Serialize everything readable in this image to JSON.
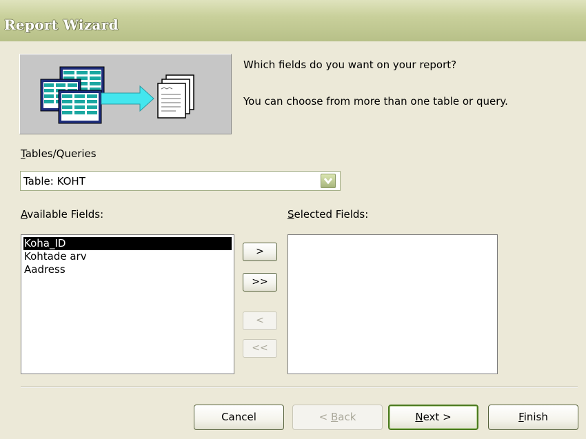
{
  "window": {
    "title": "Report Wizard"
  },
  "prompt": {
    "line1": "Which fields do you want on your report?",
    "line2": "You can choose from more than one table or query."
  },
  "tables_queries": {
    "label_mnemonic": "T",
    "label_rest": "ables/Queries",
    "selected_value": "Table: KOHT"
  },
  "available_fields": {
    "label_mnemonic": "A",
    "label_rest": "vailable Fields:",
    "items": [
      "Koha_ID",
      "Kohtade arv",
      "Aadress"
    ],
    "selected_item": "Koha_ID"
  },
  "selected_fields": {
    "label_mnemonic": "S",
    "label_rest": "elected Fields:",
    "items": []
  },
  "move_buttons": {
    "add_one": ">",
    "add_all": ">>",
    "remove_one": "<",
    "remove_all": "<<"
  },
  "footer": {
    "cancel": "Cancel",
    "back_prefix": "< ",
    "back_mnemonic": "B",
    "back_rest": "ack",
    "next_mnemonic": "N",
    "next_rest": "ext >",
    "finish_mnemonic": "F",
    "finish_rest": "inish"
  },
  "colors": {
    "title_bar": "#c9d09b",
    "dialog_background": "#ece9d8",
    "selection_background": "#000000",
    "default_button_border": "#4b7a1f"
  },
  "icons": {
    "illustration": "tables-to-report-illustration",
    "combo_dropdown": "chevron-down-icon"
  }
}
